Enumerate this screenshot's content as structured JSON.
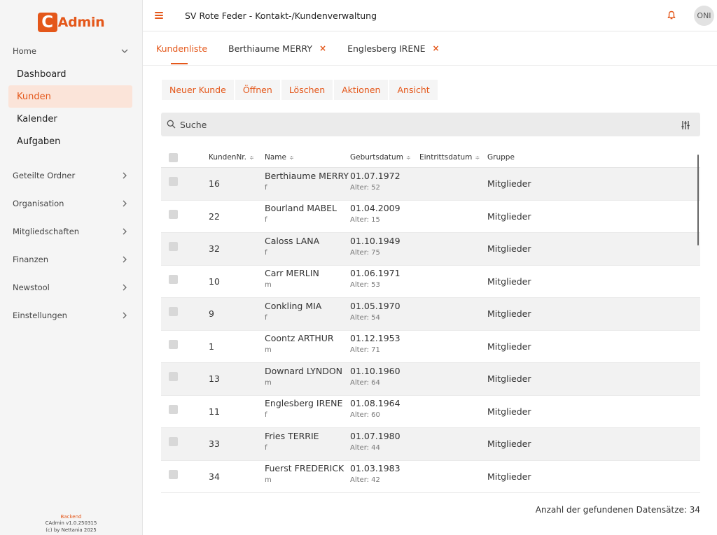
{
  "logo": {
    "letter": "C",
    "text": "Admin"
  },
  "sidebar": {
    "home": "Home",
    "subitems": [
      {
        "label": "Dashboard",
        "active": false
      },
      {
        "label": "Kunden",
        "active": true
      },
      {
        "label": "Kalender",
        "active": false
      },
      {
        "label": "Aufgaben",
        "active": false
      }
    ],
    "groups": [
      "Geteilte Ordner",
      "Organisation",
      "Mitgliedschaften",
      "Finanzen",
      "Newstool",
      "Einstellungen"
    ],
    "footer": {
      "line1": "Backend",
      "line2": "CAdmin v1.0.250315",
      "line3": "(c) by Nettania 2025"
    }
  },
  "topbar": {
    "title": "SV Rote Feder - Kontakt-/Kundenverwaltung",
    "avatar": "ONI"
  },
  "tabs": [
    {
      "label": "Kundenliste",
      "closable": false
    },
    {
      "label": "Berthiaume MERRY",
      "closable": true
    },
    {
      "label": "Englesberg IRENE",
      "closable": true
    }
  ],
  "tab_close_symbol": "×",
  "toolbar": [
    "Neuer Kunde",
    "Öffnen",
    "Löschen",
    "Aktionen",
    "Ansicht"
  ],
  "search": {
    "placeholder": "Suche"
  },
  "table": {
    "headers": {
      "nr": "KundenNr.",
      "name": "Name",
      "birth": "Geburtsdatum",
      "entry": "Eintrittsdatum",
      "group": "Gruppe"
    },
    "sort_symbol": "≑",
    "rows": [
      {
        "nr": "16",
        "name": "Berthiaume MERRY",
        "sex": "f",
        "birth": "01.07.1972",
        "age": "Alter: 52",
        "group": "Mitglieder"
      },
      {
        "nr": "22",
        "name": "Bourland MABEL",
        "sex": "f",
        "birth": "01.04.2009",
        "age": "Alter: 15",
        "group": "Mitglieder"
      },
      {
        "nr": "32",
        "name": "Caloss LANA",
        "sex": "f",
        "birth": "01.10.1949",
        "age": "Alter: 75",
        "group": "Mitglieder"
      },
      {
        "nr": "10",
        "name": "Carr MERLIN",
        "sex": "m",
        "birth": "01.06.1971",
        "age": "Alter: 53",
        "group": "Mitglieder"
      },
      {
        "nr": "9",
        "name": "Conkling MIA",
        "sex": "f",
        "birth": "01.05.1970",
        "age": "Alter: 54",
        "group": "Mitglieder"
      },
      {
        "nr": "1",
        "name": "Coontz ARTHUR",
        "sex": "m",
        "birth": "01.12.1953",
        "age": "Alter: 71",
        "group": "Mitglieder"
      },
      {
        "nr": "13",
        "name": "Downard LYNDON",
        "sex": "m",
        "birth": "01.10.1960",
        "age": "Alter: 64",
        "group": "Mitglieder"
      },
      {
        "nr": "11",
        "name": "Englesberg IRENE",
        "sex": "f",
        "birth": "01.08.1964",
        "age": "Alter: 60",
        "group": "Mitglieder"
      },
      {
        "nr": "33",
        "name": "Fries TERRIE",
        "sex": "f",
        "birth": "01.07.1980",
        "age": "Alter: 44",
        "group": "Mitglieder"
      },
      {
        "nr": "34",
        "name": "Fuerst FREDERICK",
        "sex": "m",
        "birth": "01.03.1983",
        "age": "Alter: 42",
        "group": "Mitglieder"
      }
    ]
  },
  "record_count": "Anzahl der gefundenen Datensätze: 34",
  "colors": {
    "accent": "#e4571a",
    "active_bg": "#fbe4d9"
  }
}
